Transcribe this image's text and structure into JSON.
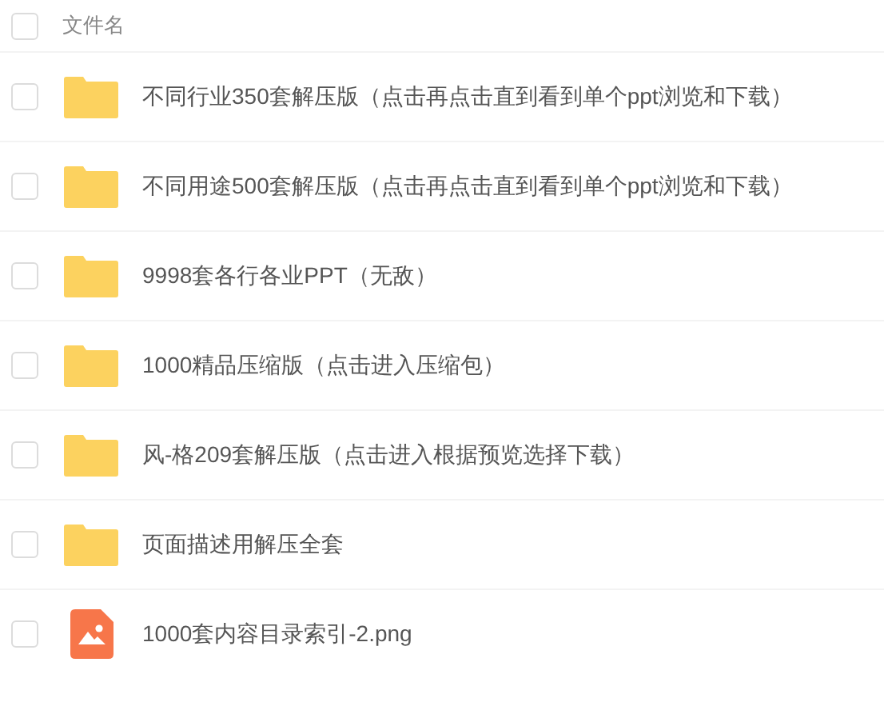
{
  "header": {
    "checked": false,
    "label": "文件名"
  },
  "files": [
    {
      "kind": "folder",
      "name": "不同行业350套解压版（点击再点击直到看到单个ppt浏览和下载）",
      "checked": false
    },
    {
      "kind": "folder",
      "name": "不同用途500套解压版（点击再点击直到看到单个ppt浏览和下载）",
      "checked": false
    },
    {
      "kind": "folder",
      "name": "9998套各行各业PPT（无敌）",
      "checked": false
    },
    {
      "kind": "folder",
      "name": "1000精品压缩版（点击进入压缩包）",
      "checked": false
    },
    {
      "kind": "folder",
      "name": "风-格209套解压版（点击进入根据预览选择下载）",
      "checked": false
    },
    {
      "kind": "folder",
      "name": "页面描述用解压全套",
      "checked": false
    },
    {
      "kind": "image",
      "name": "1000套内容目录索引-2.png",
      "checked": false
    }
  ]
}
